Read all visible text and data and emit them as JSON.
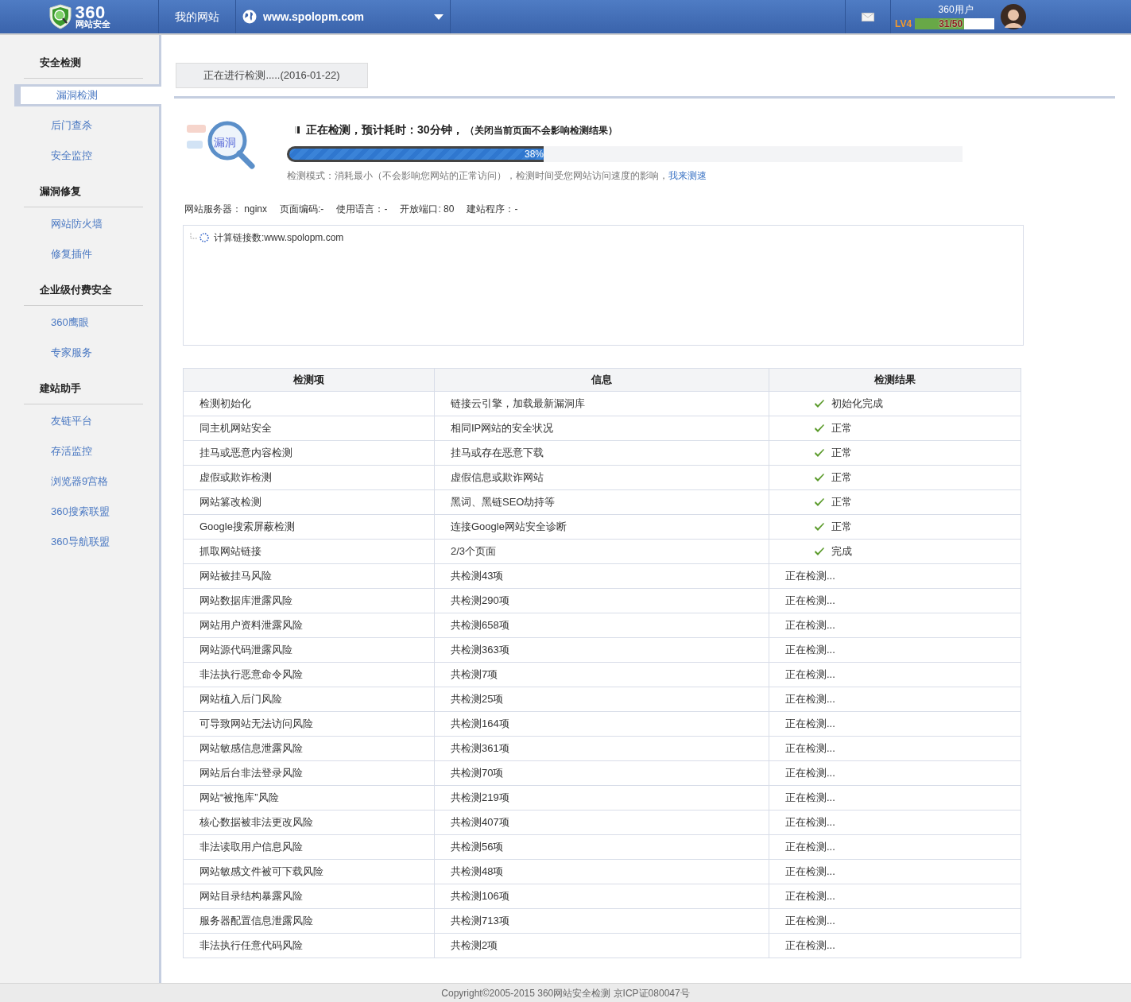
{
  "header": {
    "logo_number": "360",
    "logo_text": "网站安全",
    "my_sites": "我的网站",
    "site": "www.spolopm.com",
    "user": "360用户",
    "level_label": "LV4",
    "exp": {
      "text": "31/50",
      "level": 0.62
    }
  },
  "sidebar": [
    {
      "title": "安全检测",
      "items": [
        {
          "label": "漏洞检测",
          "selected": true
        },
        {
          "label": "后门查杀",
          "selected": false
        },
        {
          "label": "安全监控",
          "selected": false
        }
      ]
    },
    {
      "title": "漏洞修复",
      "items": [
        {
          "label": "网站防火墙",
          "selected": false
        },
        {
          "label": "修复插件",
          "selected": false
        }
      ]
    },
    {
      "title": "企业级付费安全",
      "items": [
        {
          "label": "360鹰眼",
          "selected": false
        },
        {
          "label": "专家服务",
          "selected": false
        }
      ]
    },
    {
      "title": "建站助手",
      "items": [
        {
          "label": "友链平台",
          "selected": false
        },
        {
          "label": "存活监控",
          "selected": false
        },
        {
          "label": "浏览器9宫格",
          "selected": false
        },
        {
          "label": "360搜索联盟",
          "selected": false
        },
        {
          "label": "360导航联盟",
          "selected": false
        }
      ]
    }
  ],
  "tab": "正在进行检测.....(2016-01-22)",
  "scan": {
    "illustration_label": "漏洞",
    "status": "正在检测，预计耗时：30分钟，",
    "note": "（关闭当前页面不会影响检测结果）",
    "level": 0.38,
    "percent": "38%",
    "mode": "检测模式：消耗最小（不会影响您网站的正常访问），检测时间受您网站访问速度的影响，",
    "speed_link": "我来测速"
  },
  "site_info": [
    "网站服务器： nginx",
    "页面编码:-",
    "使用语言：-",
    "开放端口: 80",
    "建站程序：-"
  ],
  "log": [
    "计算链接数:www.spolopm.com"
  ],
  "table": {
    "columns": [
      "检测项",
      "信息",
      "检测结果"
    ],
    "rows": [
      {
        "item": "检测初始化",
        "info": "链接云引擎，加载最新漏洞库",
        "result": "初始化完成",
        "kind": "done"
      },
      {
        "item": "同主机网站安全",
        "info": "相同IP网站的安全状况",
        "result": "正常",
        "kind": "done"
      },
      {
        "item": "挂马或恶意内容检测",
        "info": "挂马或存在恶意下载",
        "result": "正常",
        "kind": "done"
      },
      {
        "item": "虚假或欺诈检测",
        "info": "虚假信息或欺诈网站",
        "result": "正常",
        "kind": "done"
      },
      {
        "item": "网站篡改检测",
        "info": "黑词、黑链SEO劫持等",
        "result": "正常",
        "kind": "done"
      },
      {
        "item": "Google搜索屏蔽检测",
        "info": "连接Google网站安全诊断",
        "result": "正常",
        "kind": "done"
      },
      {
        "item": "抓取网站链接",
        "info": "2/3个页面",
        "result": "完成",
        "kind": "done"
      },
      {
        "item": "网站被挂马风险",
        "info": "共检测43项",
        "result": "正在检测...",
        "kind": "running"
      },
      {
        "item": "网站数据库泄露风险",
        "info": "共检测290项",
        "result": "正在检测...",
        "kind": "running"
      },
      {
        "item": "网站用户资料泄露风险",
        "info": "共检测658项",
        "result": "正在检测...",
        "kind": "running"
      },
      {
        "item": "网站源代码泄露风险",
        "info": "共检测363项",
        "result": "正在检测...",
        "kind": "running"
      },
      {
        "item": "非法执行恶意命令风险",
        "info": "共检测7项",
        "result": "正在检测...",
        "kind": "running"
      },
      {
        "item": "网站植入后门风险",
        "info": "共检测25项",
        "result": "正在检测...",
        "kind": "running"
      },
      {
        "item": "可导致网站无法访问风险",
        "info": "共检测164项",
        "result": "正在检测...",
        "kind": "running"
      },
      {
        "item": "网站敏感信息泄露风险",
        "info": "共检测361项",
        "result": "正在检测...",
        "kind": "running"
      },
      {
        "item": "网站后台非法登录风险",
        "info": "共检测70项",
        "result": "正在检测...",
        "kind": "running"
      },
      {
        "item": "网站“被拖库”风险",
        "info": "共检测219项",
        "result": "正在检测...",
        "kind": "running"
      },
      {
        "item": "核心数据被非法更改风险",
        "info": "共检测407项",
        "result": "正在检测...",
        "kind": "running"
      },
      {
        "item": "非法读取用户信息风险",
        "info": "共检测56项",
        "result": "正在检测...",
        "kind": "running"
      },
      {
        "item": "网站敏感文件被可下载风险",
        "info": "共检测48项",
        "result": "正在检测...",
        "kind": "running"
      },
      {
        "item": "网站目录结构暴露风险",
        "info": "共检测106项",
        "result": "正在检测...",
        "kind": "running"
      },
      {
        "item": "服务器配置信息泄露风险",
        "info": "共检测713项",
        "result": "正在检测...",
        "kind": "running"
      },
      {
        "item": "非法执行任意代码风险",
        "info": "共检测2项",
        "result": "正在检测...",
        "kind": "running"
      }
    ]
  },
  "footer": "Copyright©2005-2015 360网站安全检测 京ICP证080047号"
}
